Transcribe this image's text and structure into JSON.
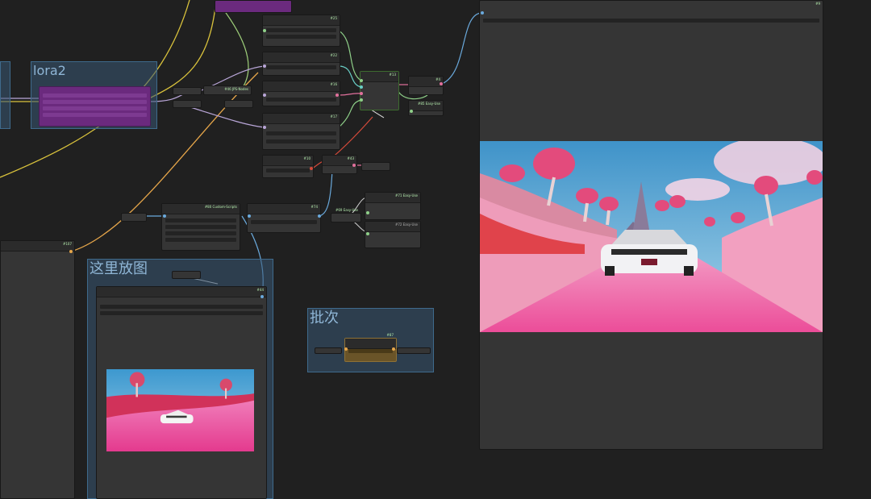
{
  "groups": {
    "lora2": "lora2",
    "place_image": "这里放图",
    "batch": "批次"
  },
  "nodes": {
    "n25": "#25",
    "n22": "#22",
    "n16": "#16",
    "n17": "#17",
    "n13": "#13",
    "n4": "#4",
    "n85": "#85 Easy-Use",
    "n46": "#46 JPS-Nodes",
    "n10": "#10",
    "n43": "#43",
    "n74": "#74",
    "n80": "#80 Custom-Scripts",
    "n71": "#71 Easy-Use",
    "n72": "#72 Easy-Use",
    "n69": "#69 Easy-Use",
    "n107": "#107",
    "n44": "#44",
    "n87": "#87",
    "n9": "#9"
  },
  "colors": {
    "background": "#202020",
    "node": "#353535",
    "group_fill": "#385874",
    "lora_node": "#6b2a7e",
    "wire_yellow": "#d9c23c",
    "wire_lavender": "#b9a6d8",
    "wire_blue": "#6aa9dc",
    "wire_green": "#8fd089",
    "wire_pink": "#e2709c",
    "wire_red": "#d44a3a",
    "wire_orange": "#e6a64a"
  },
  "preview": {
    "subject": "white electric car on pink striped road through pink mushroom forest"
  }
}
